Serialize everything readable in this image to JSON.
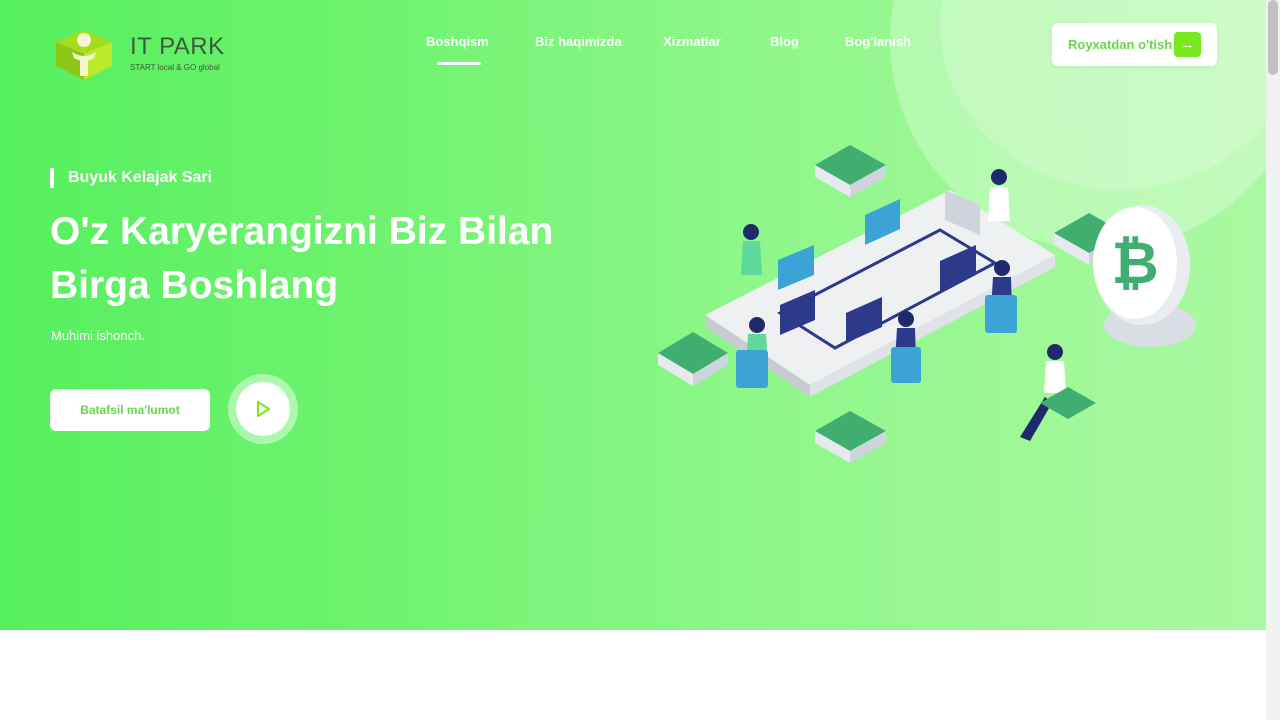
{
  "brand": {
    "name": "IT PARK",
    "tagline": "START local & GO global"
  },
  "nav": {
    "items": [
      {
        "label": "Boshqism",
        "active": true
      },
      {
        "label": "Biz haqimizda",
        "active": false
      },
      {
        "label": "Xizmatlar",
        "active": false
      },
      {
        "label": "Blog",
        "active": false
      },
      {
        "label": "Bog'lanish",
        "active": false
      }
    ]
  },
  "header": {
    "register_label": "Royxatdan o'tish",
    "register_icon": "arrow-right-icon"
  },
  "hero": {
    "eyebrow": "Buyuk Kelajak Sari",
    "headline_line1": "O'z Karyerangizni Biz Bilan",
    "headline_line2": "Birga Boshlang",
    "subtext": "Muhimi ishonch.",
    "more_button": "Batafsil ma'lumot",
    "play_icon": "play-icon"
  },
  "colors": {
    "accent": "#78e81f",
    "accent_text": "#66d94a",
    "hero_start": "#56ef5e",
    "hero_end": "#abf8a2"
  }
}
